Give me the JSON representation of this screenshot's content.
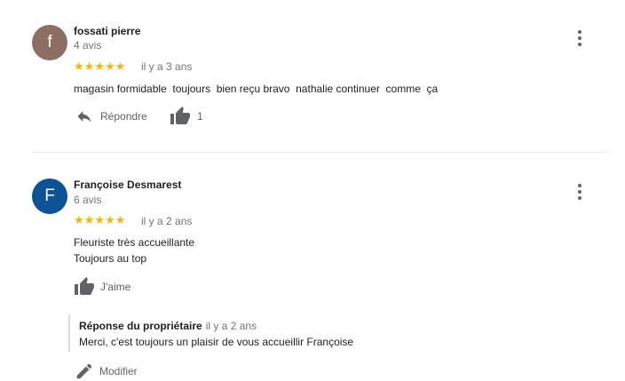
{
  "reviews": [
    {
      "avatar_letter": "f",
      "avatar_color": "#8d6e63",
      "name": "fossati pierre",
      "review_count": "4 avis",
      "stars": "★★★★★",
      "time": "il y a 3 ans",
      "text": "magasin formidable  toujours  bien reçu bravo  nathalie continuer  comme  ça",
      "reply_label": "Répondre",
      "like_count": "1"
    },
    {
      "avatar_letter": "F",
      "avatar_color": "#0b5394",
      "name": "Françoise Desmarest",
      "review_count": "6 avis",
      "stars": "★★★★★",
      "time": "il y a 2 ans",
      "text_lines": [
        "Fleuriste très accueillante",
        "Toujours au top"
      ],
      "like_label": "J'aime",
      "owner_reply": {
        "title": "Réponse du propriétaire",
        "time": "il y a 2 ans",
        "text": "Merci, c'est toujours un plaisir de vous accueillir Françoise"
      },
      "edit_label": "Modifier"
    }
  ],
  "colors": {
    "star": "#f5b50a",
    "muted": "#70757a",
    "icon": "#5f6368"
  }
}
